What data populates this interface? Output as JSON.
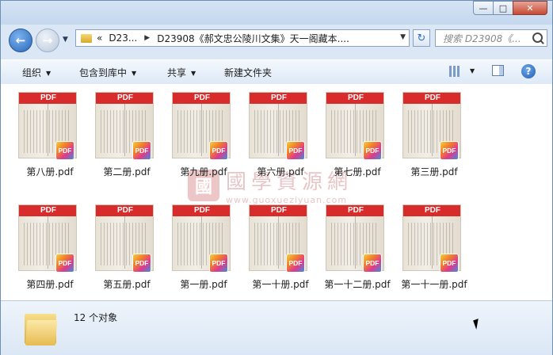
{
  "window": {
    "controls": {
      "minimize": "—",
      "maximize": "□",
      "close": "✕"
    }
  },
  "nav": {
    "back_icon": "arrow-left",
    "forward_icon": "arrow-right",
    "breadcrumb": [
      {
        "label": "«"
      },
      {
        "label": "D23..."
      },
      {
        "label": "D23908《郝文忠公陵川文集》天一阁藏本...."
      }
    ],
    "search_placeholder": "搜索 D23908《..."
  },
  "toolbar": {
    "organize": "组织",
    "include_in_library": "包含到库中",
    "share": "共享",
    "new_folder": "新建文件夹"
  },
  "files": [
    {
      "name": "第八册.pdf",
      "badge": "PDF"
    },
    {
      "name": "第二册.pdf",
      "badge": "PDF"
    },
    {
      "name": "第九册.pdf",
      "badge": "PDF"
    },
    {
      "name": "第六册.pdf",
      "badge": "PDF"
    },
    {
      "name": "第七册.pdf",
      "badge": "PDF"
    },
    {
      "name": "第三册.pdf",
      "badge": "PDF"
    },
    {
      "name": "第四册.pdf",
      "badge": "PDF"
    },
    {
      "name": "第五册.pdf",
      "badge": "PDF"
    },
    {
      "name": "第一册.pdf",
      "badge": "PDF"
    },
    {
      "name": "第一十册.pdf",
      "badge": "PDF"
    },
    {
      "name": "第一十二册.pdf",
      "badge": "PDF"
    },
    {
      "name": "第一十一册.pdf",
      "badge": "PDF"
    }
  ],
  "thumbnail_header": "PDF",
  "watermark": {
    "seal": "國",
    "title": "國學資源網",
    "url": "www.guoxueziyuan.com"
  },
  "status": {
    "count_text": "12 个对象"
  },
  "colors": {
    "pdf_red": "#d82b2b",
    "chrome_blue": "#dbe7f5"
  }
}
